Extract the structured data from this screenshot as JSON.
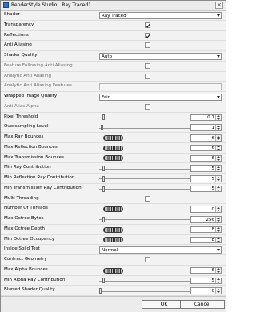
{
  "window": {
    "title": "RenderStyle Studio:  Ray Traced1",
    "close_glyph": "×"
  },
  "rows": [
    {
      "label": "Shader",
      "control": "dropdown",
      "value": "Ray Traced"
    },
    {
      "label": "Transparency",
      "control": "checkbox",
      "checked": true
    },
    {
      "label": "Reflections",
      "control": "checkbox",
      "checked": true
    },
    {
      "label": "Anti Aliasing",
      "control": "checkbox",
      "checked": false
    },
    {
      "label": "Shader Quality",
      "control": "dropdown",
      "value": "Auto"
    },
    {
      "label": "Feature Following Anti Aliasing",
      "control": "checkbox",
      "checked": false,
      "disabled": true
    },
    {
      "label": "Analytic Anti Aliasing",
      "control": "checkbox",
      "checked": false,
      "disabled": true
    },
    {
      "label": "Analytic Anti Aliasing Features",
      "control": "button",
      "value": "...",
      "disabled": true
    },
    {
      "label": "Wrapped Image Quality",
      "control": "dropdown",
      "value": "Fair"
    },
    {
      "label": "Anti Alias Alpha",
      "control": "checkbox",
      "checked": false,
      "disabled": true
    },
    {
      "label": "Pixel Threshold",
      "control": "slider",
      "value": "0.1",
      "fraction": 0.04
    },
    {
      "label": "Oversampling Level",
      "control": "slider",
      "value": "1",
      "fraction": 0.02
    },
    {
      "label": "Max Ray Bounces",
      "control": "wheel",
      "value": "6"
    },
    {
      "label": "Max Reflection Bounces",
      "control": "wheel",
      "value": "6"
    },
    {
      "label": "Max Transmission Bounces",
      "control": "wheel",
      "value": "6"
    },
    {
      "label": "Min Ray Contribution",
      "control": "slider",
      "value": "5",
      "fraction": 0.04
    },
    {
      "label": "Min Reflection Ray Contribution",
      "control": "slider",
      "value": "5",
      "fraction": 0.04
    },
    {
      "label": "Min Transmission Ray Contribution",
      "control": "slider",
      "value": "5",
      "fraction": 0.04
    },
    {
      "label": "Multi Threading",
      "control": "checkbox",
      "checked": false
    },
    {
      "label": "Number Of Threads",
      "control": "wheel",
      "value": "0"
    },
    {
      "label": "Max Octree Bytes",
      "control": "slider",
      "value": "256",
      "fraction": 0.04
    },
    {
      "label": "Max Octree Depth",
      "control": "wheel",
      "value": "8"
    },
    {
      "label": "Min Octree Occupancy",
      "control": "wheel",
      "value": "8"
    },
    {
      "label": "Inside Solid Test",
      "control": "dropdown",
      "value": "Normal"
    },
    {
      "label": "Contract Geometry",
      "control": "checkbox",
      "checked": false
    },
    {
      "label": "Max Alpha Bounces",
      "control": "wheel",
      "value": "6"
    },
    {
      "label": "Min Alpha Ray Contribution",
      "control": "slider",
      "value": "5",
      "fraction": 0.04
    },
    {
      "label": "Blurred Shader Quality",
      "control": "slider",
      "value": "0",
      "fraction": 0.0
    }
  ],
  "footer": {
    "ok_label": "OK",
    "cancel_label": "Cancel"
  }
}
